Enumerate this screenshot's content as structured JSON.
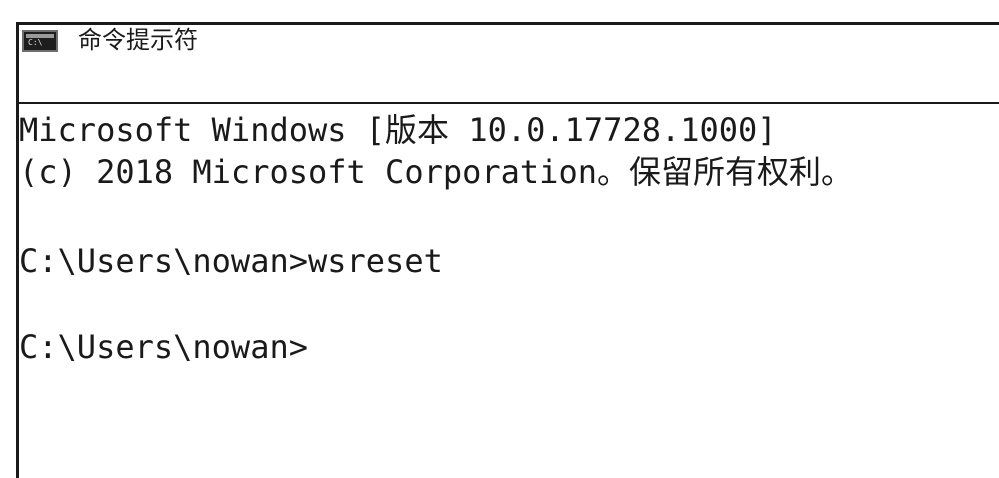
{
  "window": {
    "title": "命令提示符",
    "icon": "command-prompt-icon",
    "icon_glyph": "C:\\"
  },
  "console": {
    "lines": [
      "Microsoft Windows [版本 10.0.17728.1000]",
      "(c) 2018 Microsoft Corporation。保留所有权利。",
      "C:\\Users\\nowan>wsreset",
      "C:\\Users\\nowan>"
    ]
  },
  "colors": {
    "background": "#ffffff",
    "text": "#1a1a1a",
    "frame": "#1a1a1a"
  }
}
